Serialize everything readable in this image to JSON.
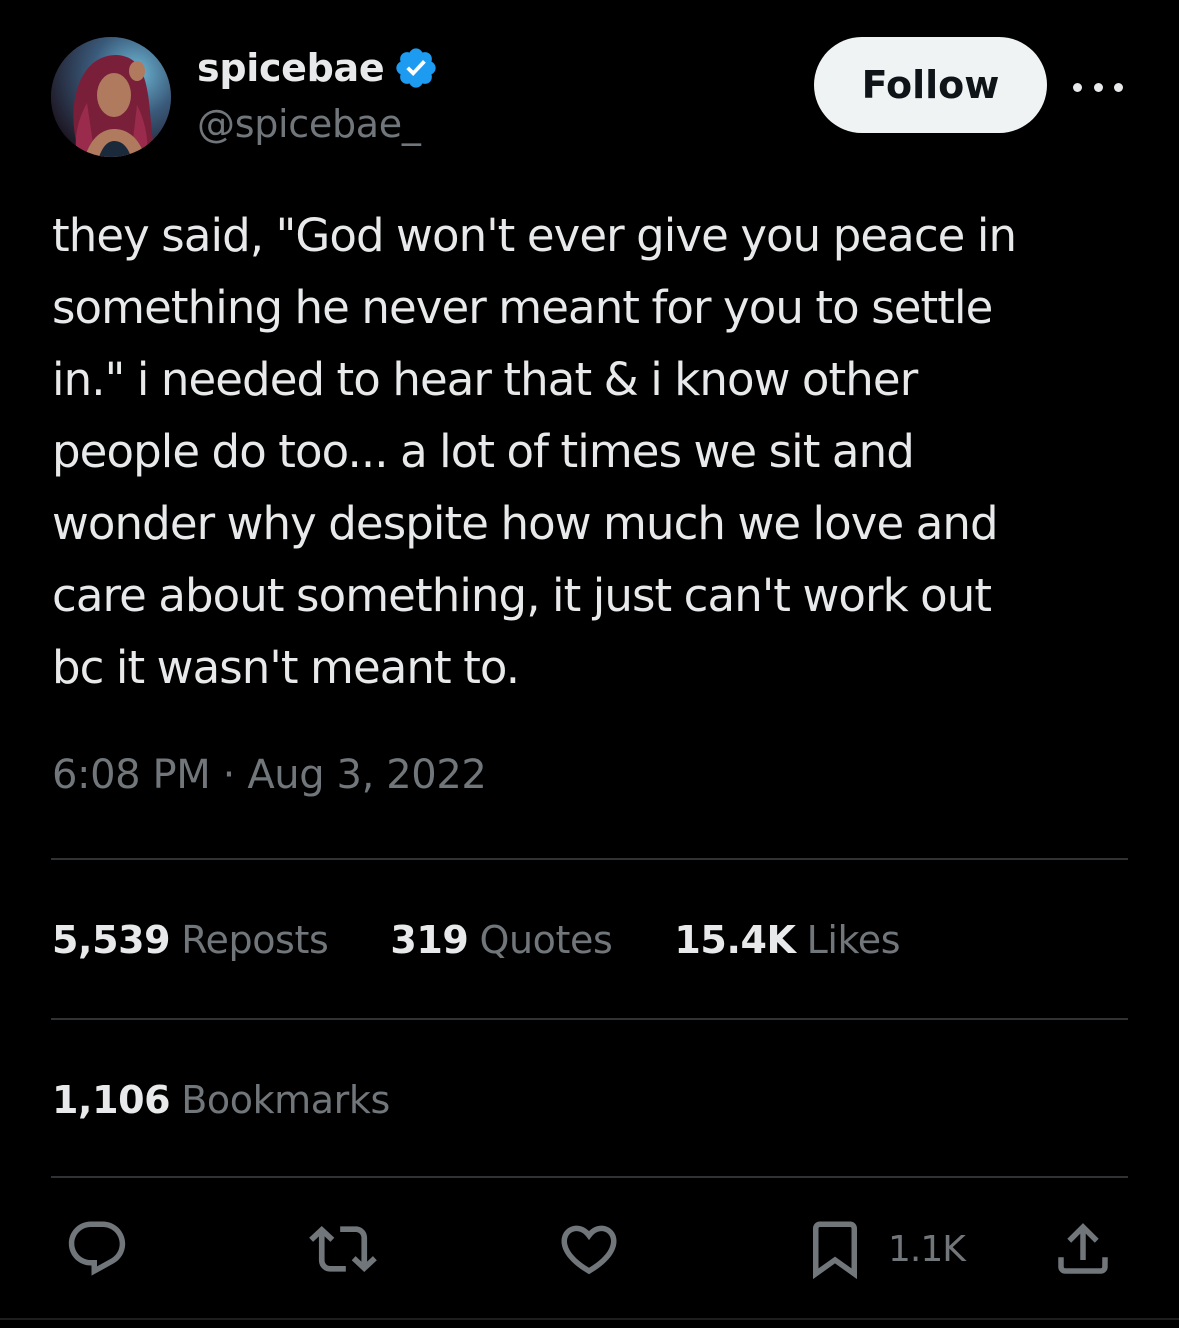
{
  "author": {
    "display_name": "spicebae",
    "handle": "@spicebae_",
    "verified": true,
    "avatar_icon": "profile-photo"
  },
  "header": {
    "follow_label": "Follow",
    "more_icon": "ellipsis-icon"
  },
  "tweet": {
    "text": "they said, \"God won't ever give you peace in\nsomething he never meant for you to settle\nin.\" i needed to hear that & i know other\npeople do too... a lot of times we sit and\nwonder why despite how much we love and\ncare about something, it just can't work out\nbc it wasn't meant to.",
    "timestamp": "6:08 PM · Aug 3, 2022"
  },
  "stats": {
    "reposts": {
      "count": "5,539",
      "label": "Reposts"
    },
    "quotes": {
      "count": "319",
      "label": "Quotes"
    },
    "likes": {
      "count": "15.4K",
      "label": "Likes"
    },
    "bookmarks": {
      "count": "1,106",
      "label": "Bookmarks"
    }
  },
  "actions": {
    "reply_icon": "reply-icon",
    "repost_icon": "repost-icon",
    "like_icon": "heart-icon",
    "bookmark_icon": "bookmark-icon",
    "bookmark_count": "1.1K",
    "share_icon": "share-icon"
  },
  "colors": {
    "background": "#000000",
    "primary_text": "#e7e9ea",
    "secondary_text": "#71767b",
    "divider": "#2f3336",
    "verified_blue": "#1d9bf0",
    "follow_button_bg": "#eff3f4"
  }
}
